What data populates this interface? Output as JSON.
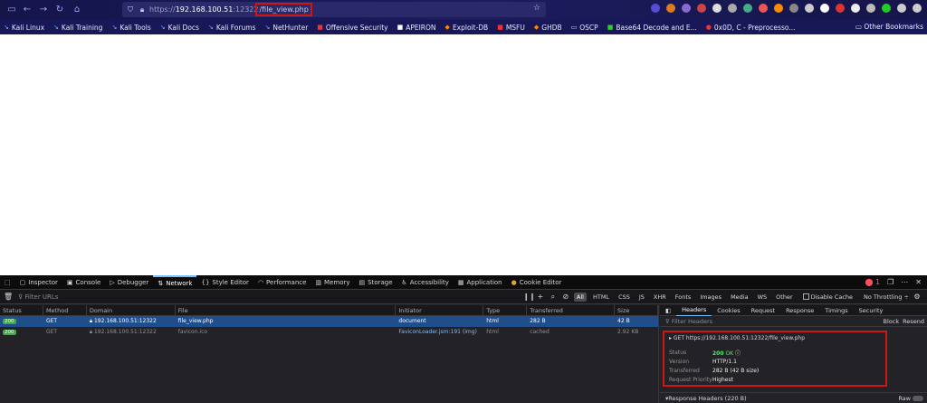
{
  "browser": {
    "url_prefix": "https://",
    "url_host": "192.168.100.51",
    "url_port": ":12322",
    "url_path": "/file_view.php"
  },
  "bookmarks": [
    "Kali Linux",
    "Kali Training",
    "Kali Tools",
    "Kali Docs",
    "Kali Forums",
    "NetHunter",
    "Offensive Security",
    "APEIRON",
    "Exploit-DB",
    "MSFU",
    "GHDB",
    "OSCP",
    "Base64 Decode and E...",
    "0x0D, C - Preprocesso..."
  ],
  "other_bookmarks": "Other Bookmarks",
  "devtools": {
    "tabs": [
      "Inspector",
      "Console",
      "Debugger",
      "Network",
      "Style Editor",
      "Performance",
      "Memory",
      "Storage",
      "Accessibility",
      "Application",
      "Cookie Editor"
    ],
    "active_tab": "Network",
    "error_count": "1",
    "filter_placeholder": "Filter URLs",
    "filter_types": [
      "All",
      "HTML",
      "CSS",
      "JS",
      "XHR",
      "Fonts",
      "Images",
      "Media",
      "WS",
      "Other"
    ],
    "disable_cache": "Disable Cache",
    "throttling": "No Throttling ÷",
    "columns": [
      "Status",
      "Method",
      "Domain",
      "File",
      "Initiator",
      "Type",
      "Transferred",
      "Size"
    ],
    "requests": [
      {
        "status": "200",
        "method": "GET",
        "domain": "192.168.100.51:12322",
        "file": "file_view.php",
        "initiator": "document",
        "type": "html",
        "transferred": "282 B",
        "size": "42 B"
      },
      {
        "status": "200",
        "method": "GET",
        "domain": "192.168.100.51:12322",
        "file": "favicon.ico",
        "initiator": "FaviconLoader.jsm:191 (img)",
        "type": "html",
        "transferred": "cached",
        "size": "2.92 KB"
      }
    ],
    "panel_tabs": [
      "Headers",
      "Cookies",
      "Request",
      "Response",
      "Timings",
      "Security"
    ],
    "panel_active": "Headers",
    "filter_headers": "Filter Headers",
    "block": "Block",
    "resend": "Resend",
    "request_line": "GET https://192.168.100.51:12322/file_view.php",
    "details": {
      "status_label": "Status",
      "status_code": "200",
      "status_text": "OK",
      "version_label": "Version",
      "version": "HTTP/1.1",
      "transferred_label": "Transferred",
      "transferred": "282 B (42 B size)",
      "priority_label": "Request Priority",
      "priority": "Highest"
    },
    "response_headers": "Response Headers (220 B)",
    "raw": "Raw"
  },
  "colors": {
    "accent": "#75bfff",
    "highlight_box": "#d01515",
    "selected_row": "#204e8a"
  }
}
